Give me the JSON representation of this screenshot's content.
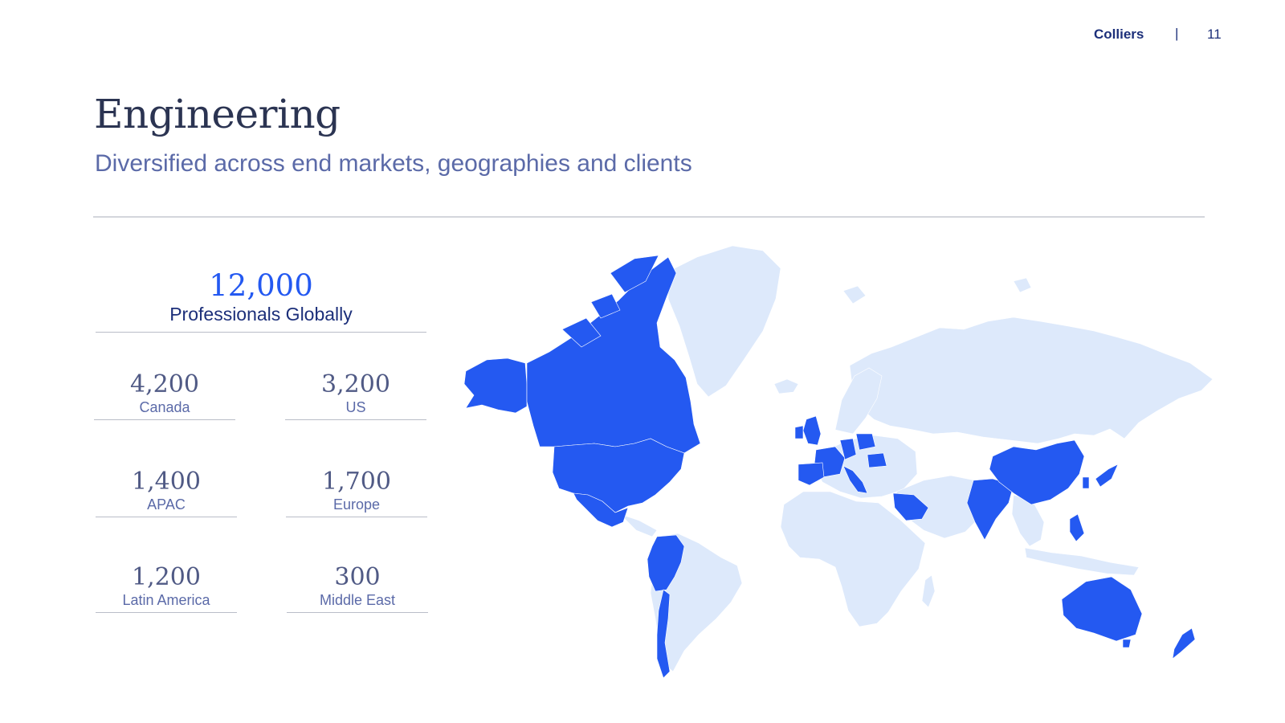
{
  "header": {
    "brand": "Colliers",
    "separator": "|",
    "page_number": "11"
  },
  "title": "Engineering",
  "subtitle": "Diversified across end markets, geographies and clients",
  "global": {
    "value": "12,000",
    "label": "Professionals Globally"
  },
  "regions": [
    {
      "value": "4,200",
      "label": "Canada"
    },
    {
      "value": "3,200",
      "label": "US"
    },
    {
      "value": "1,400",
      "label": "APAC"
    },
    {
      "value": "1,700",
      "label": "Europe"
    },
    {
      "value": "1,200",
      "label": "Latin America"
    },
    {
      "value": "300",
      "label": "Middle East"
    }
  ],
  "map": {
    "highlight_color": "#2459f1",
    "base_color": "#dde9fb",
    "highlighted_countries": [
      "Canada",
      "United States",
      "Mexico",
      "Colombia",
      "Ecuador",
      "Peru",
      "Chile",
      "United Kingdom",
      "Ireland",
      "France",
      "Spain",
      "Portugal",
      "Italy",
      "Germany",
      "Poland",
      "Romania",
      "Saudi Arabia",
      "India",
      "China",
      "South Korea",
      "Japan",
      "Philippines",
      "Australia",
      "New Zealand"
    ]
  }
}
